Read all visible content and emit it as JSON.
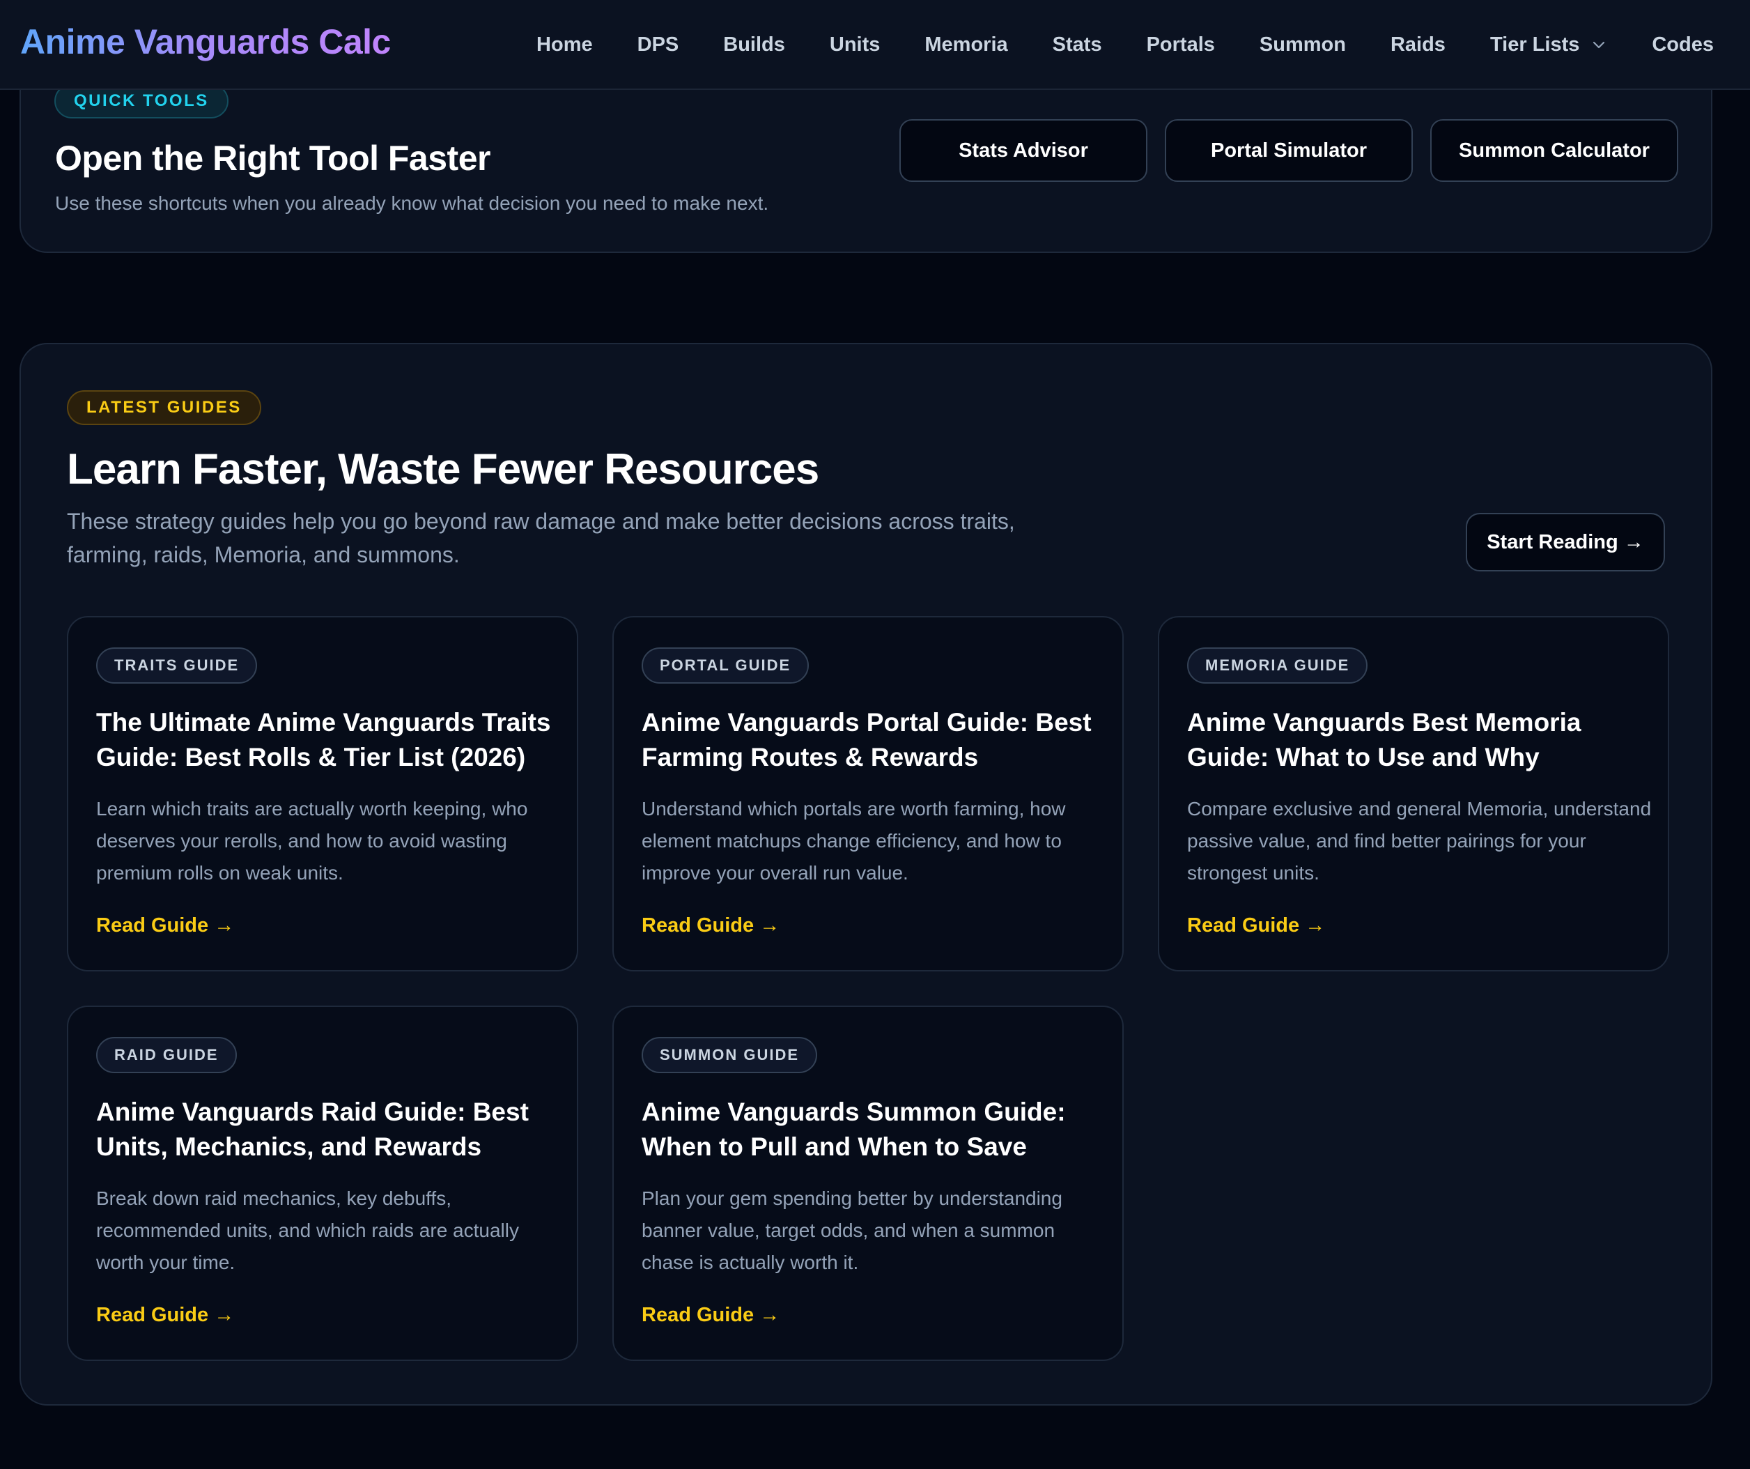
{
  "nav": {
    "brand": "Anime Vanguards Calc",
    "links": [
      "Home",
      "DPS",
      "Builds",
      "Units",
      "Memoria",
      "Stats",
      "Portals",
      "Summon",
      "Raids",
      "Tier Lists",
      "Codes"
    ]
  },
  "quick_tools": {
    "badge": "QUICK TOOLS",
    "title": "Open the Right Tool Faster",
    "subtitle": "Use these shortcuts when you already know what decision you need to make next.",
    "buttons": [
      "Stats Advisor",
      "Portal Simulator",
      "Summon Calculator"
    ]
  },
  "guides": {
    "badge": "LATEST GUIDES",
    "title": "Learn Faster, Waste Fewer Resources",
    "subtitle": "These strategy guides help you go beyond raw damage and make better decisions across traits, farming, raids, Memoria, and summons.",
    "cta": "Start Reading →",
    "cards": [
      {
        "tag": "TRAITS GUIDE",
        "title": "The Ultimate Anime Vanguards Traits Guide: Best Rolls & Tier List (2026)",
        "description": "Learn which traits are actually worth keeping, who deserves your rerolls, and how to avoid wasting premium rolls on weak units.",
        "link": "Read Guide →"
      },
      {
        "tag": "PORTAL GUIDE",
        "title": "Anime Vanguards Portal Guide: Best Farming Routes & Rewards",
        "description": "Understand which portals are worth farming, how element matchups change efficiency, and how to improve your overall run value.",
        "link": "Read Guide →"
      },
      {
        "tag": "MEMORIA GUIDE",
        "title": "Anime Vanguards Best Memoria Guide: What to Use and Why",
        "description": "Compare exclusive and general Memoria, understand passive value, and find better pairings for your strongest units.",
        "link": "Read Guide →"
      },
      {
        "tag": "RAID GUIDE",
        "title": "Anime Vanguards Raid Guide: Best Units, Mechanics, and Rewards",
        "description": "Break down raid mechanics, key debuffs, recommended units, and which raids are actually worth your time.",
        "link": "Read Guide →"
      },
      {
        "tag": "SUMMON GUIDE",
        "title": "Anime Vanguards Summon Guide: When to Pull and When to Save",
        "description": "Plan your gem spending better by understanding banner value, target odds, and when a summon chase is actually worth it.",
        "link": "Read Guide →"
      }
    ]
  },
  "colors": {
    "page_bg": "#030712",
    "panel_bg": "#0b1221",
    "card_bg": "#060c19",
    "accent_cyan": "#22d3ee",
    "accent_yellow": "#facc15",
    "brand_gradient": [
      "#60a5fa",
      "#a78bfa",
      "#c084fc"
    ]
  },
  "icons": {
    "tier_lists_dropdown": "chevron-down-icon"
  }
}
